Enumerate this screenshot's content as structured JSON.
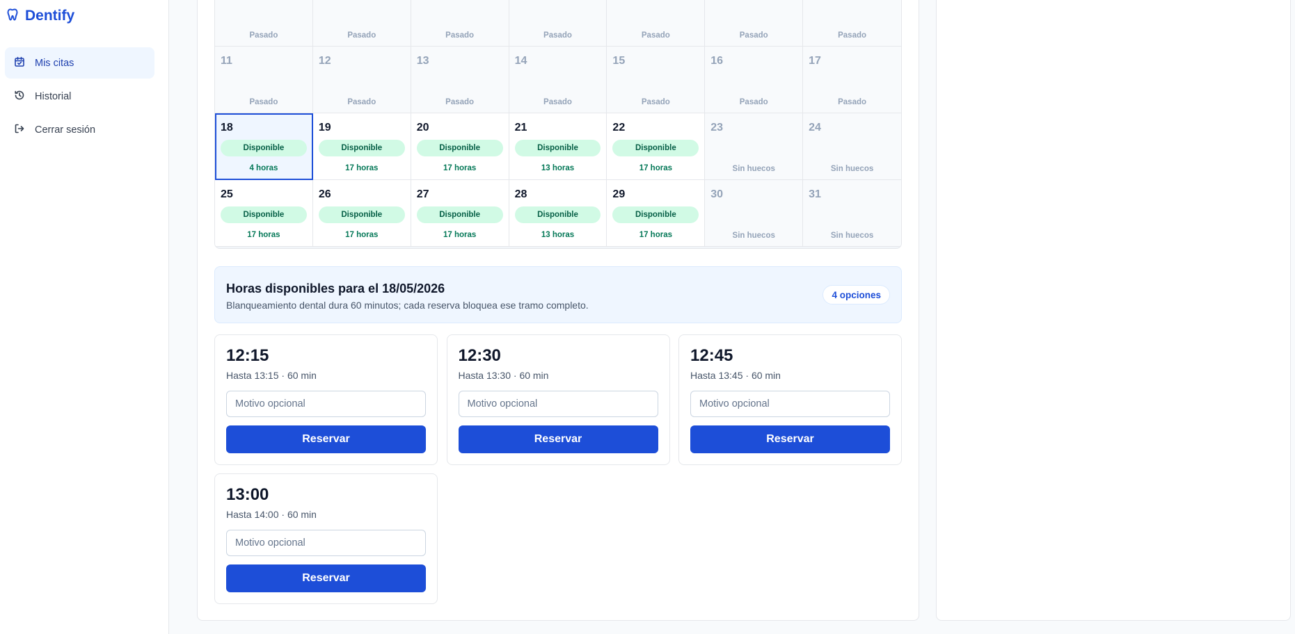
{
  "sidebar": {
    "brand": "Dentify",
    "items": [
      {
        "label": "Mis citas",
        "icon": "calendar-icon",
        "active": true
      },
      {
        "label": "Historial",
        "icon": "history-icon",
        "active": false
      },
      {
        "label": "Cerrar sesión",
        "icon": "logout-icon",
        "active": false
      }
    ]
  },
  "calendar": {
    "weeks": [
      [
        {
          "day": "",
          "status": "Pasado"
        },
        {
          "day": "",
          "status": "Pasado"
        },
        {
          "day": "",
          "status": "Pasado"
        },
        {
          "day": "",
          "status": "Pasado"
        },
        {
          "day": "",
          "status": "Pasado"
        },
        {
          "day": "",
          "status": "Pasado"
        },
        {
          "day": "",
          "status": "Pasado"
        }
      ],
      [
        {
          "day": "11",
          "status": "Pasado"
        },
        {
          "day": "12",
          "status": "Pasado"
        },
        {
          "day": "13",
          "status": "Pasado"
        },
        {
          "day": "14",
          "status": "Pasado"
        },
        {
          "day": "15",
          "status": "Pasado"
        },
        {
          "day": "16",
          "status": "Pasado"
        },
        {
          "day": "17",
          "status": "Pasado"
        }
      ],
      [
        {
          "day": "18",
          "status": "Disponible",
          "hours": "4 horas",
          "selected": true
        },
        {
          "day": "19",
          "status": "Disponible",
          "hours": "17 horas"
        },
        {
          "day": "20",
          "status": "Disponible",
          "hours": "17 horas"
        },
        {
          "day": "21",
          "status": "Disponible",
          "hours": "13 horas"
        },
        {
          "day": "22",
          "status": "Disponible",
          "hours": "17 horas"
        },
        {
          "day": "23",
          "status": "Sin huecos"
        },
        {
          "day": "24",
          "status": "Sin huecos"
        }
      ],
      [
        {
          "day": "25",
          "status": "Disponible",
          "hours": "17 horas"
        },
        {
          "day": "26",
          "status": "Disponible",
          "hours": "17 horas"
        },
        {
          "day": "27",
          "status": "Disponible",
          "hours": "17 horas"
        },
        {
          "day": "28",
          "status": "Disponible",
          "hours": "13 horas"
        },
        {
          "day": "29",
          "status": "Disponible",
          "hours": "17 horas"
        },
        {
          "day": "30",
          "status": "Sin huecos"
        },
        {
          "day": "31",
          "status": "Sin huecos"
        }
      ]
    ]
  },
  "availability": {
    "title": "Horas disponibles para el 18/05/2026",
    "subtitle": "Blanqueamiento dental dura 60 minutos; cada reserva bloquea ese tramo completo.",
    "badge": "4 opciones"
  },
  "slots": [
    {
      "time": "12:15",
      "until": "Hasta 13:15 · 60 min",
      "placeholder": "Motivo opcional",
      "button": "Reservar"
    },
    {
      "time": "12:30",
      "until": "Hasta 13:30 · 60 min",
      "placeholder": "Motivo opcional",
      "button": "Reservar"
    },
    {
      "time": "12:45",
      "until": "Hasta 13:45 · 60 min",
      "placeholder": "Motivo opcional",
      "button": "Reservar"
    },
    {
      "time": "13:00",
      "until": "Hasta 14:00 · 60 min",
      "placeholder": "Motivo opcional",
      "button": "Reservar"
    }
  ],
  "colors": {
    "accent": "#1d4ed8",
    "available_pill": "#d1fae5",
    "available_text": "#065f46",
    "muted_text": "#94a3b8"
  }
}
